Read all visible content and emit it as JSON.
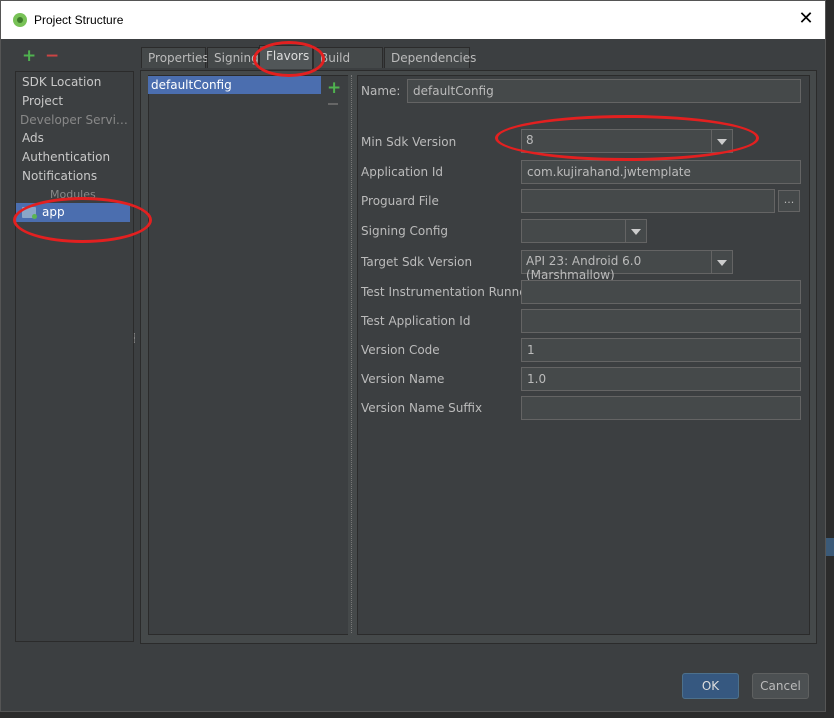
{
  "window": {
    "title": "Project Structure",
    "close_label": "✕"
  },
  "sidebar": {
    "add_label": "+",
    "remove_label": "−",
    "items": [
      {
        "label": "SDK Location"
      },
      {
        "label": "Project"
      },
      {
        "label": "Developer Servi…"
      },
      {
        "label": "Ads"
      },
      {
        "label": "Authentication"
      },
      {
        "label": "Notifications"
      }
    ],
    "modules_header": "Modules",
    "selected_module": "app"
  },
  "tabs": [
    {
      "label": "Properties"
    },
    {
      "label": "Signing"
    },
    {
      "label": "Flavors"
    },
    {
      "label": "Build Types"
    },
    {
      "label": "Dependencies"
    }
  ],
  "active_tab": "Flavors",
  "flavors": {
    "items": [
      "defaultConfig"
    ],
    "add_label": "+"
  },
  "form": {
    "name_label": "Name:",
    "name_value": "defaultConfig",
    "min_sdk_label": "Min Sdk Version",
    "min_sdk_value": "8",
    "application_id_label": "Application Id",
    "application_id_value": "com.kujirahand.jwtemplate",
    "proguard_label": "Proguard File",
    "proguard_value": "",
    "browse_label": "...",
    "signing_label": "Signing Config",
    "signing_value": "",
    "target_sdk_label": "Target Sdk Version",
    "target_sdk_value": "API 23: Android 6.0 (Marshmallow)",
    "test_runner_label": "Test Instrumentation Runner",
    "test_runner_value": "",
    "test_app_id_label": "Test Application Id",
    "test_app_id_value": "",
    "version_code_label": "Version Code",
    "version_code_value": "1",
    "version_name_label": "Version Name",
    "version_name_value": "1.0",
    "version_suffix_label": "Version Name Suffix",
    "version_suffix_value": ""
  },
  "buttons": {
    "ok": "OK",
    "cancel": "Cancel"
  },
  "colors": {
    "selection": "#4b6eaf",
    "highlight_ring": "#e32020",
    "add_green": "#4fb24f",
    "remove_red": "#cc4444"
  }
}
